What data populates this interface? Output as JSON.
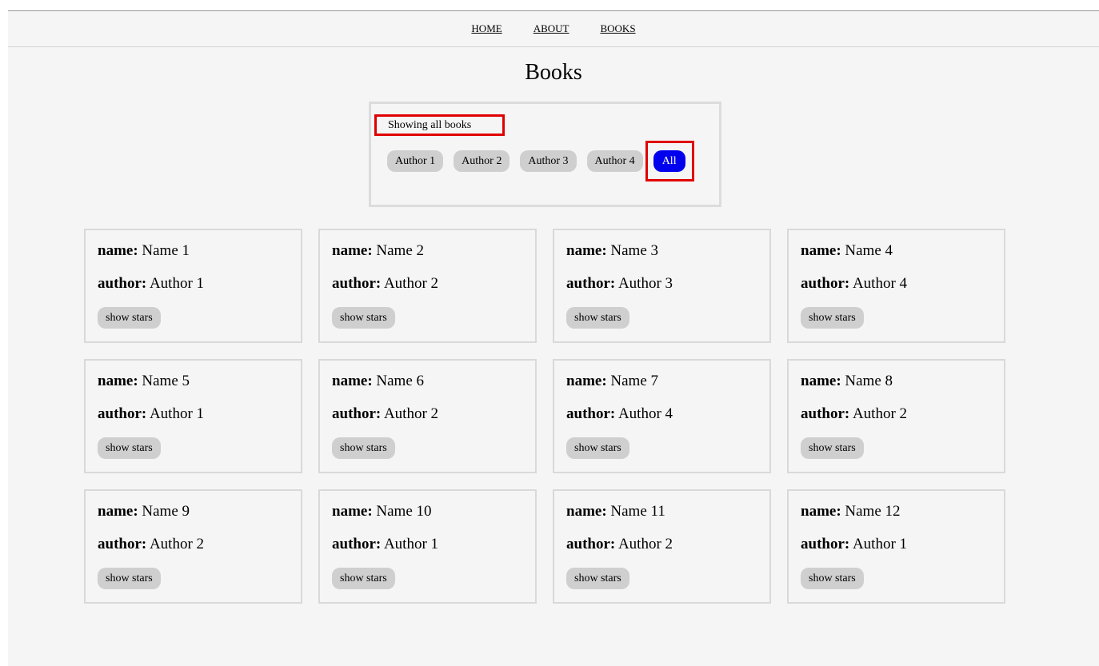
{
  "nav": {
    "items": [
      {
        "label": "HOME"
      },
      {
        "label": "ABOUT"
      },
      {
        "label": "BOOKS"
      }
    ]
  },
  "page": {
    "title": "Books"
  },
  "filter": {
    "status": "Showing all books",
    "buttons": [
      {
        "label": "Author 1",
        "active": false
      },
      {
        "label": "Author 2",
        "active": false
      },
      {
        "label": "Author 3",
        "active": false
      },
      {
        "label": "Author 4",
        "active": false
      },
      {
        "label": "All",
        "active": true
      }
    ],
    "active_color": "#0000ee",
    "highlight_color": "#e00000"
  },
  "books": {
    "name_label": "name:",
    "author_label": "author:",
    "button_label": "show stars",
    "items": [
      {
        "name": "Name 1",
        "author": "Author 1"
      },
      {
        "name": "Name 2",
        "author": "Author 2"
      },
      {
        "name": "Name 3",
        "author": "Author 3"
      },
      {
        "name": "Name 4",
        "author": "Author 4"
      },
      {
        "name": "Name 5",
        "author": "Author 1"
      },
      {
        "name": "Name 6",
        "author": "Author 2"
      },
      {
        "name": "Name 7",
        "author": "Author 4"
      },
      {
        "name": "Name 8",
        "author": "Author 2"
      },
      {
        "name": "Name 9",
        "author": "Author 2"
      },
      {
        "name": "Name 10",
        "author": "Author 1"
      },
      {
        "name": "Name 11",
        "author": "Author 2"
      },
      {
        "name": "Name 12",
        "author": "Author 1"
      }
    ]
  }
}
